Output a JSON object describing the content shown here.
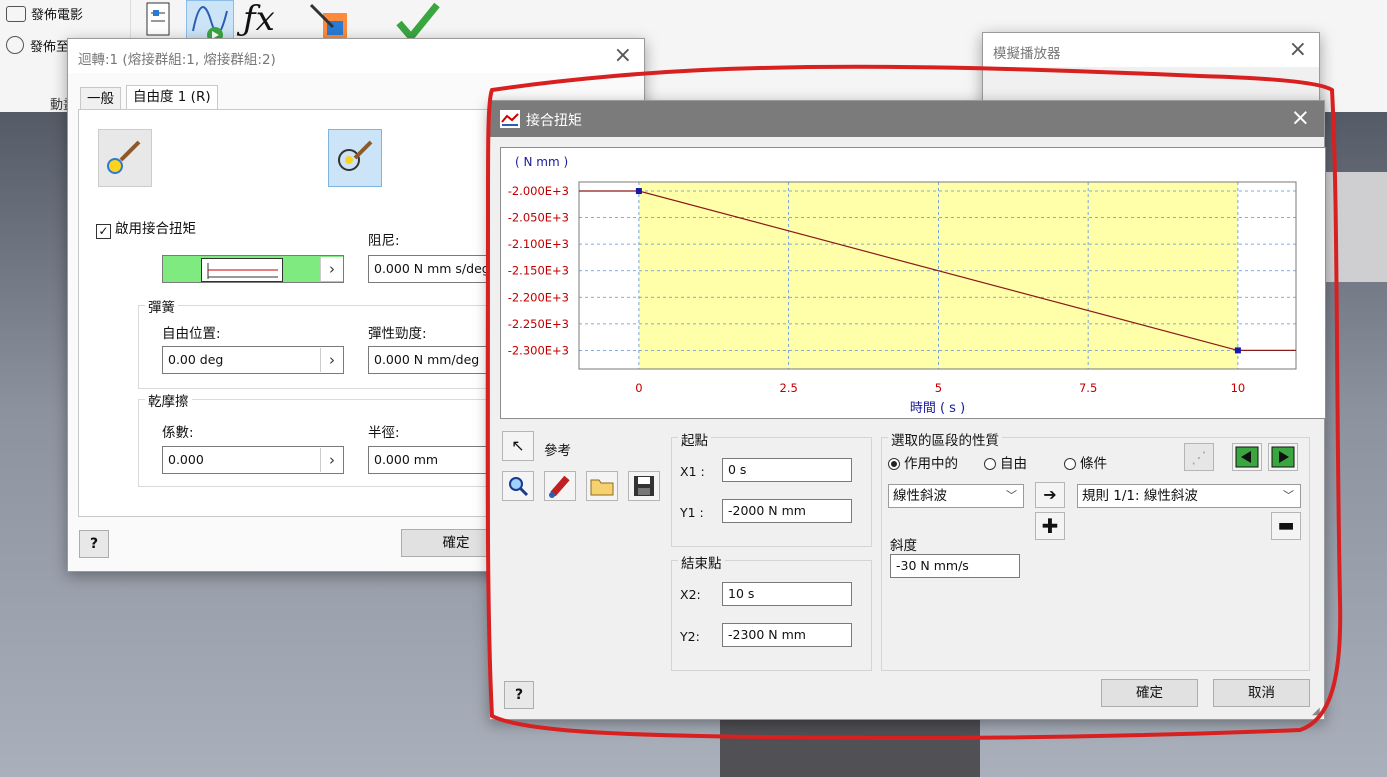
{
  "ribbon": {
    "publish_movie": "發佈電影",
    "publish_to": "發佈至",
    "animate_label": "動畫"
  },
  "joint_dialog": {
    "title": "迴轉:1 (熔接群組:1, 熔接群組:2)",
    "tabs": [
      "一般",
      "自由度 1 (R)"
    ],
    "enable_torque_label": "啟用接合扭矩",
    "enable_torque_checked": true,
    "damping_label": "阻尼:",
    "damping_value": "0.000 N mm s/deg",
    "spring_group": "彈簧",
    "free_position_label": "自由位置:",
    "free_position_value": "0.00 deg",
    "stiffness_label": "彈性勁度:",
    "stiffness_value": "0.000 N mm/deg",
    "dry_friction_group": "乾摩擦",
    "coefficient_label": "係數:",
    "coefficient_value": "0.000",
    "radius_label": "半徑:",
    "radius_value": "0.000 mm",
    "ok_label": "確定",
    "help_glyph": "?"
  },
  "sim_player": {
    "title": "模擬播放器"
  },
  "torque_dialog": {
    "title": "接合扭矩",
    "reference_label": "參考",
    "start_group": "起點",
    "x1_label": "X1 :",
    "x1_value": "0 s",
    "y1_label": "Y1 :",
    "y1_value": "-2000 N mm",
    "end_group": "結束點",
    "x2_label": "X2:",
    "x2_value": "10 s",
    "y2_label": "Y2:",
    "y2_value": "-2300 N mm",
    "segment_group": "選取的區段的性質",
    "radio_active": "作用中的",
    "radio_free": "自由",
    "radio_condition": "條件",
    "selected_radio": "active",
    "curve_type": "線性斜波",
    "rule_select": "規則 1/1: 線性斜波",
    "slope_label": "斜度",
    "slope_value": "-30 N mm/s",
    "ok_label": "確定",
    "cancel_label": "取消",
    "help_glyph": "?"
  },
  "chart_data": {
    "type": "line",
    "title": "",
    "ylabel": "( N mm )",
    "xlabel": "時間 ( s )",
    "x_ticks": [
      "0",
      "2.5",
      "5",
      "7.5",
      "10"
    ],
    "y_ticks": [
      "-2.000E+3",
      "-2.050E+3",
      "-2.100E+3",
      "-2.150E+3",
      "-2.200E+3",
      "-2.250E+3",
      "-2.300E+3"
    ],
    "xlim": [
      -1,
      10.97
    ],
    "ylim": [
      -2335,
      -1983
    ],
    "highlight_range": [
      0,
      10
    ],
    "grid": true,
    "colors": {
      "line": "#8b1a1a",
      "highlight": "#ffffaa",
      "grid": "#5c8fd6",
      "point": "#1a1aa8",
      "ytick": "#c00000",
      "xtick": "#c00000",
      "axis_title": "#1a1a9a"
    },
    "series": [
      {
        "x": [
          -1,
          0,
          10,
          10.97
        ],
        "y": [
          -2000,
          -2000,
          -2300,
          -2300
        ]
      }
    ],
    "points": [
      {
        "x": 0,
        "y": -2000
      },
      {
        "x": 10,
        "y": -2300
      }
    ]
  }
}
